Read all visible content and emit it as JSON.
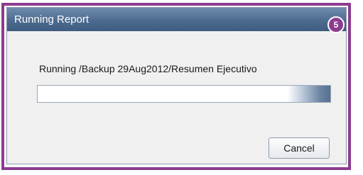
{
  "dialog": {
    "title": "Running Report",
    "message": "Running /Backup 29Aug2012/Resumen Ejecutivo",
    "cancel_label": "Cancel"
  },
  "callout": {
    "badge_number": "5",
    "color": "#8c3b8f"
  },
  "progress": {
    "state": "indeterminate"
  }
}
